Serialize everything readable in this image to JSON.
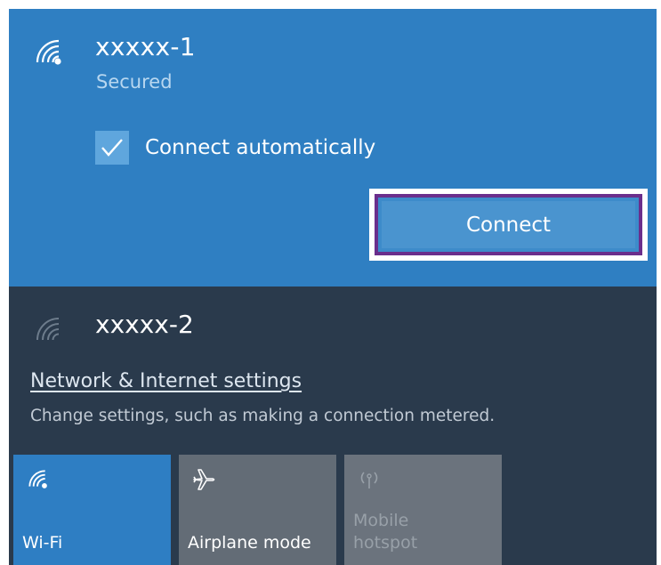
{
  "selected_network": {
    "name": "xxxxx-1",
    "status": "Secured",
    "auto_connect_label": "Connect automatically",
    "auto_connect_checked": true,
    "connect_label": "Connect"
  },
  "other_network": {
    "name": "xxxxx-2"
  },
  "settings": {
    "link_label": "Network & Internet settings",
    "description": "Change settings, such as making a connection metered."
  },
  "quick_actions": {
    "wifi": {
      "label": "Wi-Fi",
      "icon": "wifi-icon",
      "active": true
    },
    "airplane": {
      "label": "Airplane mode",
      "icon": "airplane-icon",
      "active": false
    },
    "hotspot": {
      "label_line1": "Mobile",
      "label_line2": "hotspot",
      "icon": "hotspot-icon",
      "active": false,
      "disabled": true
    }
  },
  "colors": {
    "accent": "#2f7fc2",
    "panel_background": "#2a3a4c",
    "highlight_border": "#6a2e8c"
  }
}
